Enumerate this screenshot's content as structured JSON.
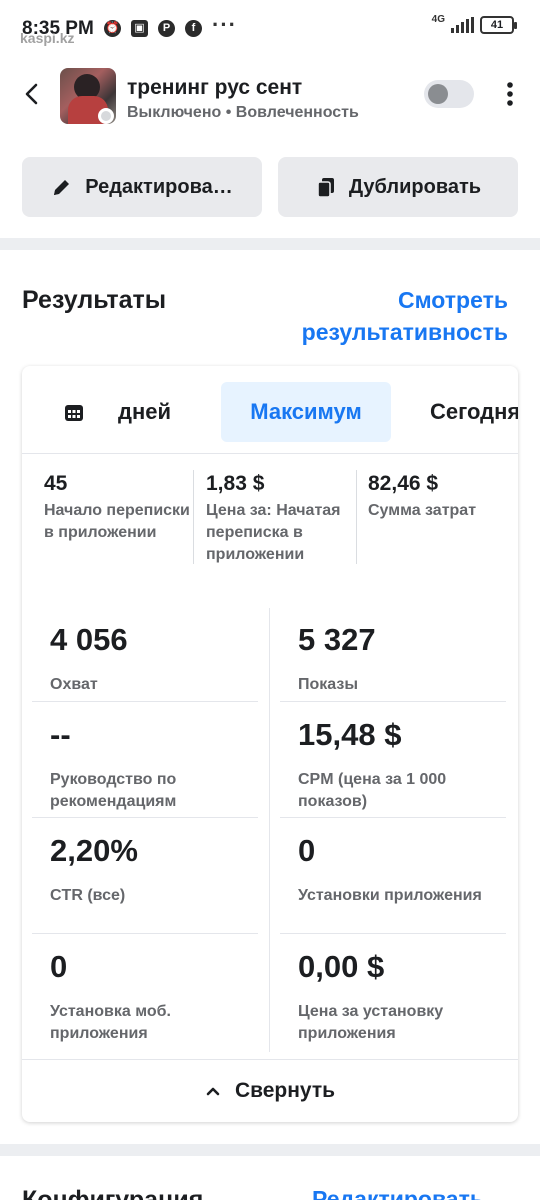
{
  "status_bar": {
    "time": "8:35 PM",
    "watermark": "kaspi.kz",
    "overflow": "···",
    "network": "4G",
    "battery": "41",
    "app_icons": [
      "alarm-icon",
      "gallery-icon",
      "pinterest-icon",
      "facebook-icon"
    ]
  },
  "header": {
    "campaign_name": "тренинг рус сент",
    "status": "Выключено",
    "separator": "•",
    "objective": "Вовлеченность",
    "toggle_on": false
  },
  "actions": {
    "edit_label": "Редактирова…",
    "duplicate_label": "Дублировать"
  },
  "results": {
    "title": "Результаты",
    "view_link": "Смотреть результативность",
    "date_tabs": {
      "days": "дней",
      "max": "Максимум",
      "today": "Сегодня"
    },
    "top_metrics": [
      {
        "value": "45",
        "label": "Начало переписки в приложении"
      },
      {
        "value": "1,83 $",
        "label": "Цена за: Начатая переписка в приложении"
      },
      {
        "value": "82,46 $",
        "label": "Сумма затрат"
      }
    ],
    "metrics": [
      {
        "value": "4 056",
        "label": "Охват"
      },
      {
        "value": "5 327",
        "label": "Показы"
      },
      {
        "value": "--",
        "label": "Руководство по рекомендациям"
      },
      {
        "value": "15,48 $",
        "label": "CPM (цена за 1 000 показов)"
      },
      {
        "value": "2,20%",
        "label": "CTR (все)"
      },
      {
        "value": "0",
        "label": "Установки приложения"
      },
      {
        "value": "0",
        "label": "Установка моб. приложения"
      },
      {
        "value": "0,00 $",
        "label": "Цена за установку приложения"
      }
    ],
    "collapse_label": "Свернуть"
  },
  "configuration": {
    "title": "Конфигурация",
    "edit_link": "Редактировать"
  },
  "colors": {
    "accent": "#1877f2",
    "selected_tab_bg": "#e7f3ff",
    "muted_text": "#65676b",
    "button_bg": "#e9eaed"
  }
}
